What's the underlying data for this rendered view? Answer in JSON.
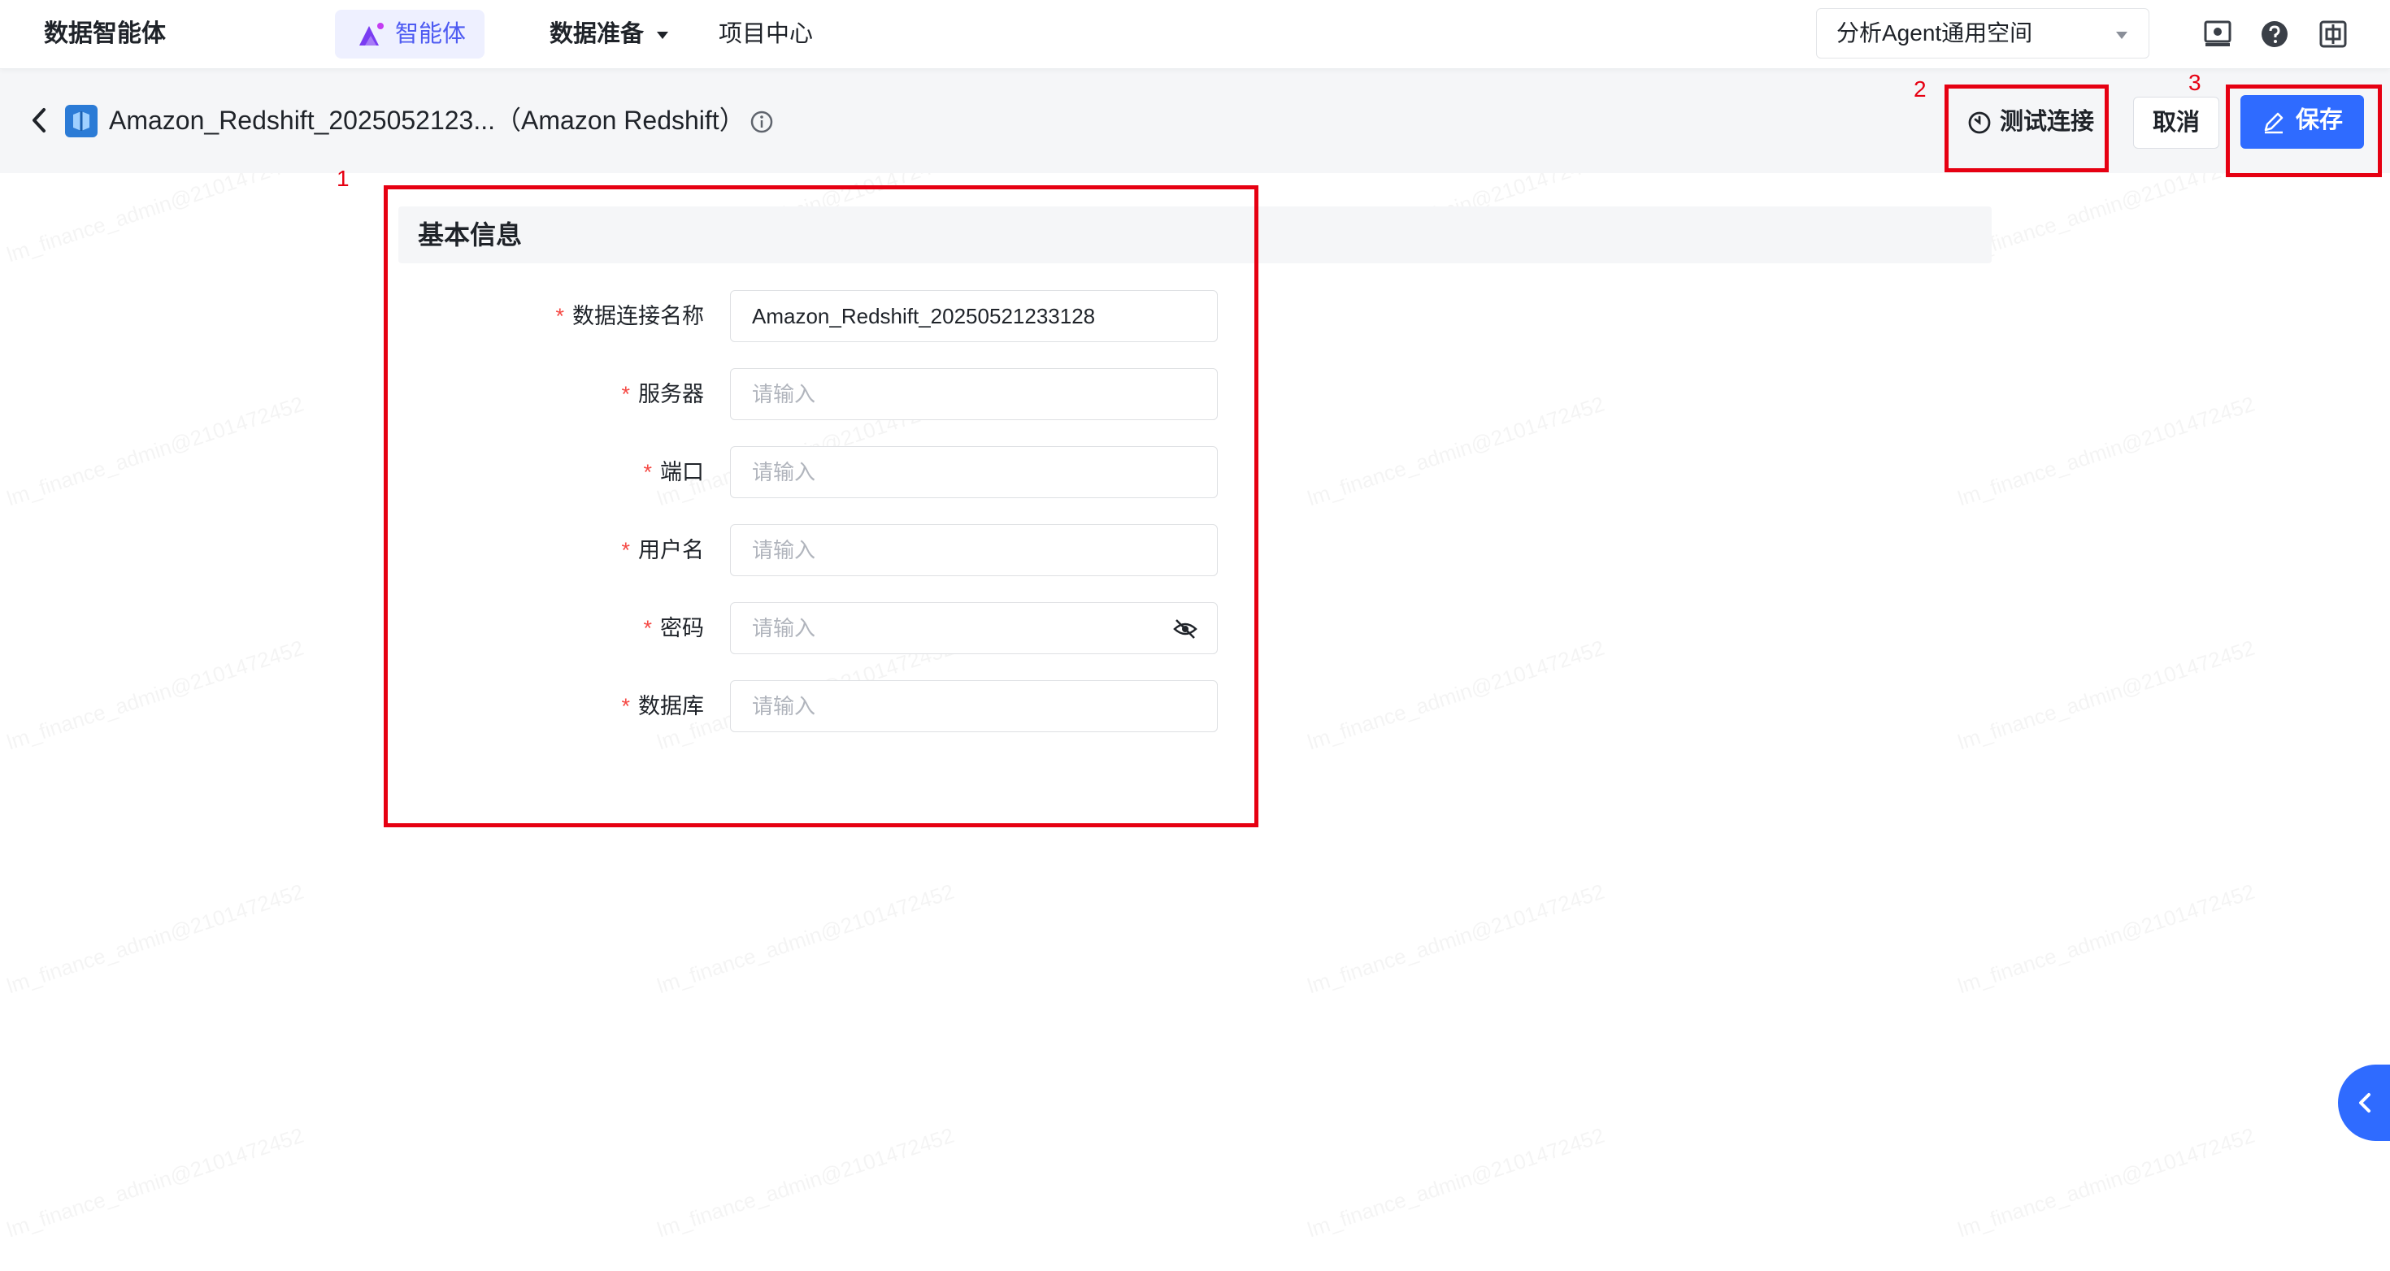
{
  "app": {
    "brand": "数据智能体"
  },
  "nav": {
    "agent_label": "智能体",
    "data_prep_label": "数据准备",
    "project_label": "项目中心"
  },
  "workspace": {
    "selected": "分析Agent通用空间"
  },
  "header": {
    "title": "Amazon_Redshift_2025052123...（Amazon Redshift）",
    "test_label": "测试连接",
    "cancel_label": "取消",
    "save_label": "保存"
  },
  "form": {
    "section_title": "基本信息",
    "required_mark": "*",
    "fields": [
      {
        "label": "数据连接名称",
        "value": "Amazon_Redshift_20250521233128",
        "placeholder": ""
      },
      {
        "label": "服务器",
        "value": "",
        "placeholder": "请输入"
      },
      {
        "label": "端口",
        "value": "",
        "placeholder": "请输入"
      },
      {
        "label": "用户名",
        "value": "",
        "placeholder": "请输入"
      },
      {
        "label": "密码",
        "value": "",
        "placeholder": "请输入"
      },
      {
        "label": "数据库",
        "value": "",
        "placeholder": "请输入"
      }
    ]
  },
  "annotations": {
    "one": "1",
    "two": "2",
    "three": "3"
  },
  "watermark": {
    "text": "lm_finance_admin@2101472452"
  },
  "colors": {
    "primary": "#2f6bff",
    "agent_accent": "#4e5bf2",
    "required": "#f54a45",
    "annotation": "#e60012"
  },
  "icons": [
    "agent-icon",
    "back-icon",
    "datasource-icon",
    "info-icon",
    "test-connection-icon",
    "edit-icon",
    "eye-off-icon",
    "screen-icon",
    "help-icon",
    "layout-icon",
    "chevron-left-icon"
  ]
}
